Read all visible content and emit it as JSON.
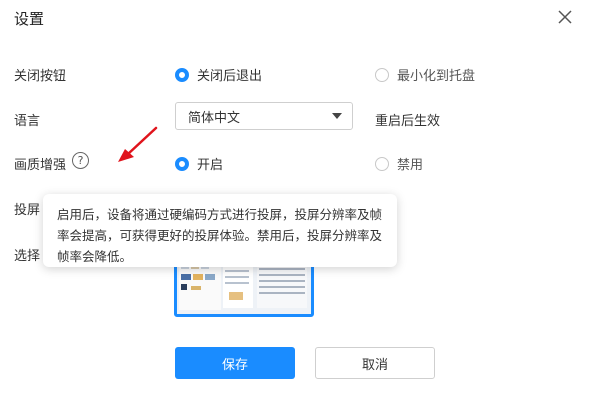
{
  "dialog": {
    "title": "设置"
  },
  "rows": {
    "close_button": {
      "label": "关闭按钮",
      "option_exit": "关闭后退出",
      "option_tray": "最小化到托盘",
      "selected": "关闭后退出"
    },
    "language": {
      "label": "语言",
      "value": "简体中文",
      "note": "重启后生效"
    },
    "quality": {
      "label": "画质增强",
      "help_glyph": "?",
      "option_on": "开启",
      "option_off": "禁用",
      "selected": "开启"
    },
    "cast_res_label_partial": "投屏",
    "select_partial": "选择"
  },
  "tooltip": {
    "text": "启用后，设备将通过硬编码方式进行投屏，投屏分辨率及帧率会提高，可获得更好的投屏体验。禁用后，投屏分辨率及帧率会降低。"
  },
  "buttons": {
    "save": "保存",
    "cancel": "取消"
  },
  "colors": {
    "accent": "#1a8cff",
    "annotation_arrow": "#e0141c"
  },
  "icons": {
    "close": "close-icon",
    "help": "help-circle-icon",
    "arrow": "red-arrow-icon"
  }
}
